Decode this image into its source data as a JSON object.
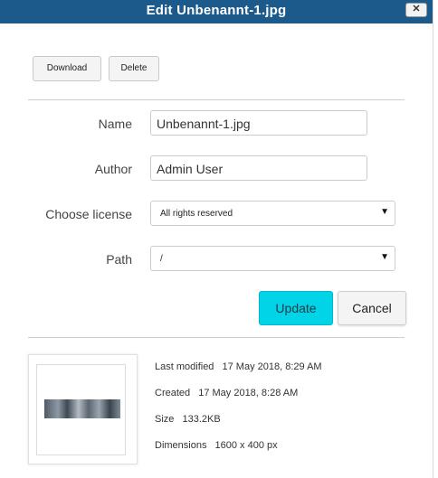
{
  "dialog": {
    "title": "Edit Unbenannt-1.jpg",
    "close_label": "✕"
  },
  "toolbar": {
    "download_label": "Download",
    "delete_label": "Delete"
  },
  "form": {
    "name_label": "Name",
    "name_value": "Unbenannt-1.jpg",
    "author_label": "Author",
    "author_value": "Admin User",
    "license_label": "Choose license",
    "license_value": "All rights reserved",
    "path_label": "Path",
    "path_value": "/",
    "caret": "▼"
  },
  "actions": {
    "update_label": "Update",
    "cancel_label": "Cancel"
  },
  "details": {
    "last_modified_label": "Last modified",
    "last_modified_value": "17 May 2018, 8:29 AM",
    "created_label": "Created",
    "created_value": "17 May 2018, 8:28 AM",
    "size_label": "Size",
    "size_value": "133.2KB",
    "dimensions_label": "Dimensions",
    "dimensions_value": "1600 x 400 px"
  },
  "colors": {
    "titlebar": "#1d5a8c",
    "update_button": "#00d4e6"
  }
}
